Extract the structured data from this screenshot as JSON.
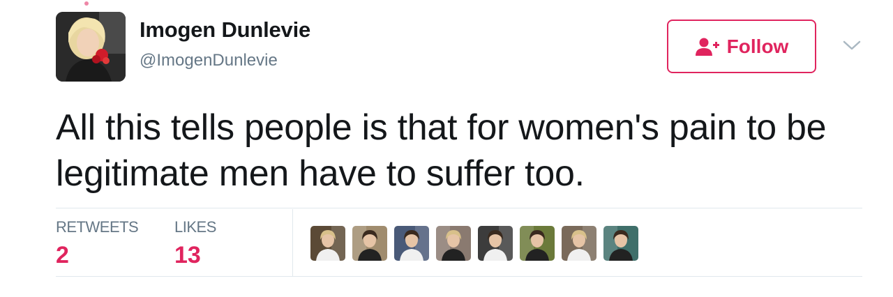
{
  "user": {
    "display_name": "Imogen Dunlevie",
    "screen_name": "@ImogenDunlevie",
    "avatar_icon": "profile-photo"
  },
  "follow_button": {
    "label": "Follow",
    "icon": "add-user-icon",
    "color": "#e0245e"
  },
  "menu": {
    "icon": "chevron-down-icon"
  },
  "tweet": {
    "text": "All this tells people is that for women's pain to be legitimate men have to suffer too."
  },
  "stats": {
    "retweets": {
      "label": "RETWEETS",
      "value": "2"
    },
    "likes": {
      "label": "LIKES",
      "value": "13"
    }
  },
  "likers": [
    {
      "icon": "liker-avatar",
      "tone": "#5b4a36"
    },
    {
      "icon": "liker-avatar",
      "tone": "#a08c6e"
    },
    {
      "icon": "liker-avatar",
      "tone": "#4a5a78"
    },
    {
      "icon": "liker-avatar",
      "tone": "#8a7a70"
    },
    {
      "icon": "liker-avatar",
      "tone": "#3c3c3c"
    },
    {
      "icon": "liker-avatar",
      "tone": "#6b7a3a"
    },
    {
      "icon": "liker-avatar",
      "tone": "#7a6a5a"
    },
    {
      "icon": "liker-avatar",
      "tone": "#3f6f6a"
    }
  ],
  "colors": {
    "accent": "#e0245e",
    "text_primary": "#14171a",
    "text_secondary": "#657786",
    "divider": "#e1e8ed"
  }
}
